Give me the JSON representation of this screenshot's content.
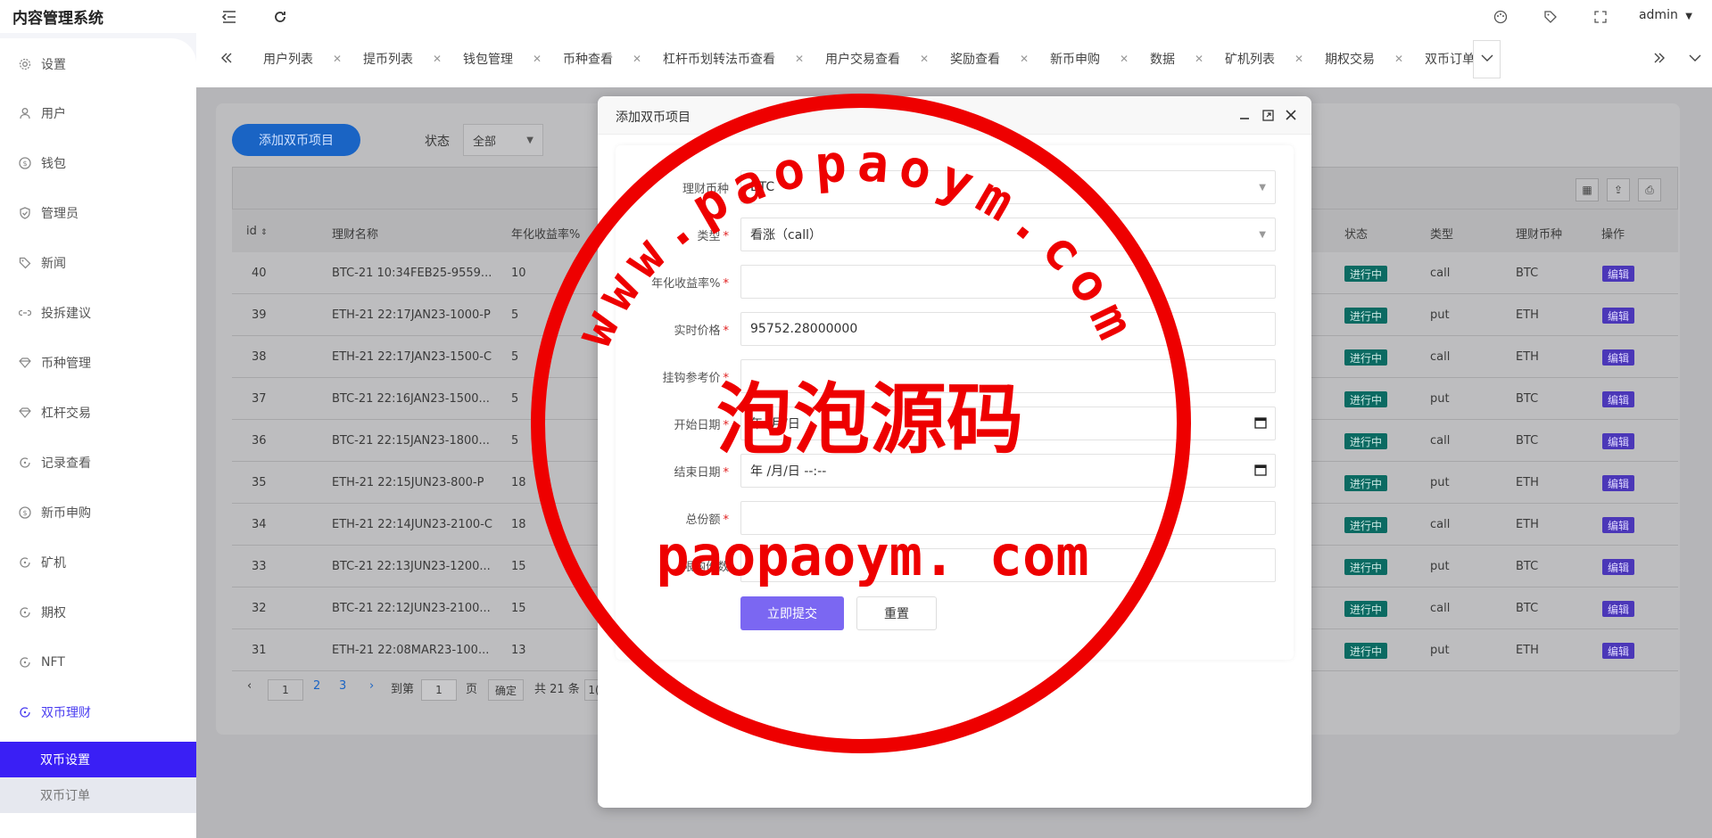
{
  "app": {
    "title": "内容管理系统",
    "user": "admin"
  },
  "sidebar": {
    "items": [
      {
        "label": "设置",
        "icon": "gear-icon"
      },
      {
        "label": "用户",
        "icon": "user-icon"
      },
      {
        "label": "钱包",
        "icon": "dollar-circle-icon"
      },
      {
        "label": "管理员",
        "icon": "shield-check-icon"
      },
      {
        "label": "新闻",
        "icon": "tag-icon"
      },
      {
        "label": "投拆建议",
        "icon": "link-icon"
      },
      {
        "label": "币种管理",
        "icon": "diamond-icon"
      },
      {
        "label": "杠杆交易",
        "icon": "diamond-icon"
      },
      {
        "label": "记录查看",
        "icon": "rotate-icon"
      },
      {
        "label": "新币申购",
        "icon": "dollar-circle-icon"
      },
      {
        "label": "矿机",
        "icon": "rotate-icon"
      },
      {
        "label": "期权",
        "icon": "rotate-icon"
      },
      {
        "label": "NFT",
        "icon": "rotate-icon"
      },
      {
        "label": "双币理财",
        "icon": "rotate-icon"
      }
    ],
    "subitems": [
      {
        "label": "双币设置"
      },
      {
        "label": "双币订单"
      }
    ]
  },
  "tabs": [
    "用户列表",
    "提币列表",
    "钱包管理",
    "币种查看",
    "杠杆币划转法币查看",
    "用户交易查看",
    "奖励查看",
    "新币申购",
    "数据",
    "矿机列表",
    "期权交易",
    "双币订单"
  ],
  "toolbar": {
    "add_label": "添加双币项目",
    "status_label": "状态",
    "status_value": "全部"
  },
  "table": {
    "columns": [
      "id",
      "理财名称",
      "年化收益率%",
      "状态",
      "类型",
      "理财币种",
      "操作"
    ],
    "rows": [
      {
        "id": "40",
        "name": "BTC-21 10:34FEB25-9559...",
        "rate": "10",
        "status": "进行中",
        "type": "call",
        "coin": "BTC",
        "action": "编辑"
      },
      {
        "id": "39",
        "name": "ETH-21 22:17JAN23-1000-P",
        "rate": "5",
        "status": "进行中",
        "type": "put",
        "coin": "ETH",
        "action": "编辑"
      },
      {
        "id": "38",
        "name": "ETH-21 22:17JAN23-1500-C",
        "rate": "5",
        "status": "进行中",
        "type": "call",
        "coin": "ETH",
        "action": "编辑"
      },
      {
        "id": "37",
        "name": "BTC-21 22:16JAN23-1500...",
        "rate": "5",
        "status": "进行中",
        "type": "put",
        "coin": "BTC",
        "action": "编辑"
      },
      {
        "id": "36",
        "name": "BTC-21 22:15JAN23-1800...",
        "rate": "5",
        "status": "进行中",
        "type": "call",
        "coin": "BTC",
        "action": "编辑"
      },
      {
        "id": "35",
        "name": "ETH-21 22:15JUN23-800-P",
        "rate": "18",
        "status": "进行中",
        "type": "put",
        "coin": "ETH",
        "action": "编辑"
      },
      {
        "id": "34",
        "name": "ETH-21 22:14JUN23-2100-C",
        "rate": "18",
        "status": "进行中",
        "type": "call",
        "coin": "ETH",
        "action": "编辑"
      },
      {
        "id": "33",
        "name": "BTC-21 22:13JUN23-1200...",
        "rate": "15",
        "status": "进行中",
        "type": "put",
        "coin": "BTC",
        "action": "编辑"
      },
      {
        "id": "32",
        "name": "BTC-21 22:12JUN23-2100...",
        "rate": "15",
        "status": "进行中",
        "type": "call",
        "coin": "BTC",
        "action": "编辑"
      },
      {
        "id": "31",
        "name": "ETH-21 22:08MAR23-100...",
        "rate": "13",
        "status": "进行中",
        "type": "put",
        "coin": "ETH",
        "action": "编辑"
      }
    ]
  },
  "pagination": {
    "pages": [
      "1",
      "2",
      "3"
    ],
    "goto_label": "到第",
    "goto_value": "1",
    "page_unit": "页",
    "confirm": "确定",
    "total": "共 21 条",
    "size_fragment": "1("
  },
  "modal": {
    "title": "添加双币项目",
    "fields": [
      {
        "label": "理财币种",
        "value": "BTC",
        "required": false,
        "kind": "select"
      },
      {
        "label": "类型",
        "value": "看涨（call）",
        "required": true,
        "kind": "select"
      },
      {
        "label": "年化收益率%",
        "value": "",
        "required": true,
        "kind": "text"
      },
      {
        "label": "实时价格",
        "value": "95752.28000000",
        "required": true,
        "kind": "text"
      },
      {
        "label": "挂钩参考价",
        "value": "",
        "required": true,
        "kind": "text"
      },
      {
        "label": "开始日期",
        "value": "年 /月/日",
        "required": true,
        "kind": "date"
      },
      {
        "label": "结束日期",
        "value": "年 /月/日 --:--",
        "required": true,
        "kind": "date"
      },
      {
        "label": "总份额",
        "value": "",
        "required": true,
        "kind": "text"
      },
      {
        "label": "限购份数",
        "value": "",
        "required": false,
        "kind": "text"
      }
    ],
    "submit": "立即提交",
    "reset": "重置",
    "required_mark": "*"
  },
  "watermark": {
    "arc_text": "www.paopaoym.com",
    "center_text": "泡泡源码",
    "bottom_text": "paopaoym. com",
    "color": "#ee0000"
  },
  "colors": {
    "accent": "#3a1ff5",
    "submit": "#7b67f2",
    "badge_green": "#0b6a62",
    "badge_purple": "#4b37b8"
  }
}
